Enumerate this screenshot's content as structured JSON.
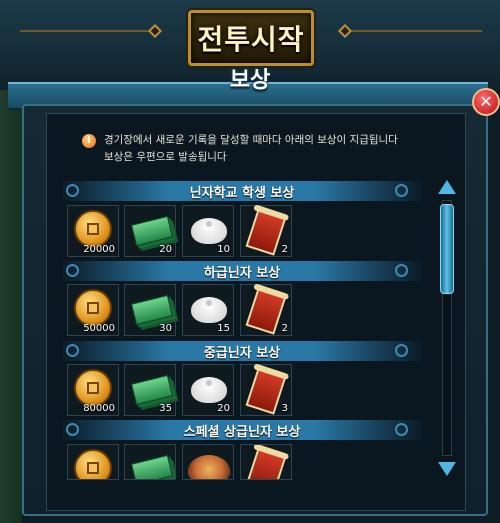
{
  "header": {
    "start_label": "전투시작",
    "title": "보상",
    "close_glyph": "✕"
  },
  "notice": {
    "line1": "경기장에서 새로운 기록을 달성할 때마다 아래의 보상이 지급됩니다",
    "line2": "보상은 우편으로 발송됩니다",
    "icon": "alert-icon"
  },
  "sections": [
    {
      "title": "닌자학교 학생 보상",
      "rewards": [
        {
          "item": "coin",
          "qty": "20000"
        },
        {
          "item": "cash",
          "qty": "20"
        },
        {
          "item": "bun",
          "qty": "10"
        },
        {
          "item": "scroll",
          "qty": "2"
        }
      ]
    },
    {
      "title": "하급닌자 보상",
      "rewards": [
        {
          "item": "coin",
          "qty": "50000"
        },
        {
          "item": "cash",
          "qty": "30"
        },
        {
          "item": "bun",
          "qty": "15"
        },
        {
          "item": "scroll",
          "qty": "2"
        }
      ]
    },
    {
      "title": "중급닌자 보상",
      "rewards": [
        {
          "item": "coin",
          "qty": "80000"
        },
        {
          "item": "cash",
          "qty": "35"
        },
        {
          "item": "bun",
          "qty": "20"
        },
        {
          "item": "scroll",
          "qty": "3"
        }
      ]
    },
    {
      "title": "스페셜 상급닌자 보상",
      "rewards": [
        {
          "item": "coin",
          "qty": ""
        },
        {
          "item": "cash",
          "qty": ""
        },
        {
          "item": "bowl",
          "qty": ""
        },
        {
          "item": "scroll",
          "qty": ""
        }
      ]
    }
  ],
  "colors": {
    "panel_border": "#3a6d86",
    "section_bar": "#2a78a6",
    "scroll_accent": "#53b6e0",
    "close_red": "#b71212"
  }
}
